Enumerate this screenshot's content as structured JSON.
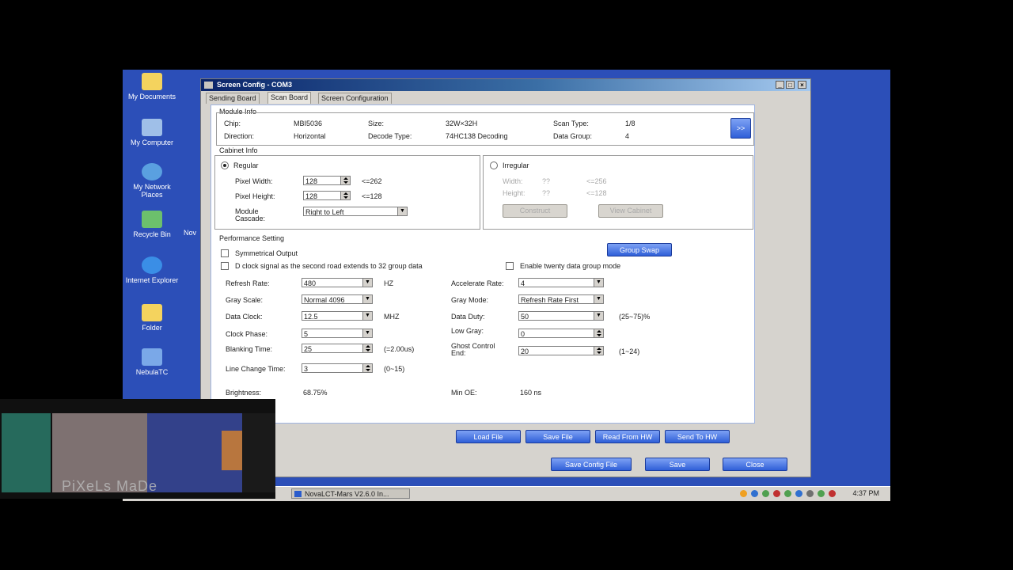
{
  "desktop": {
    "icons": [
      {
        "label": "My Documents",
        "icon": "folder-icon",
        "color": "#f4d35e"
      },
      {
        "label": "My Computer",
        "icon": "computer-icon",
        "color": "#9fbfe8"
      },
      {
        "label": "My Network Places",
        "icon": "network-icon",
        "color": "#5aa0e0"
      },
      {
        "label": "Recycle Bin",
        "icon": "recycle-bin-icon",
        "color": "#6cc06c"
      },
      {
        "label": "Internet Explorer",
        "icon": "internet-explorer-icon",
        "color": "#3a8ee6"
      },
      {
        "label": "Folder",
        "icon": "folder-icon",
        "color": "#f4d35e"
      },
      {
        "label": "NebulaTC",
        "icon": "app-icon",
        "color": "#7aa8e8"
      }
    ],
    "partial_label": "Nov"
  },
  "window": {
    "title": "Screen Config - COM3",
    "tabs": [
      "Sending Board",
      "Scan Board",
      "Screen Configuration"
    ],
    "active_tab": "Scan Board"
  },
  "module_info": {
    "group_label": "Module Info",
    "chip_label": "Chip:",
    "chip": "MBI5036",
    "size_label": "Size:",
    "size": "32W×32H",
    "scan_type_label": "Scan Type:",
    "scan_type": "1/8",
    "direction_label": "Direction:",
    "direction": "Horizontal",
    "decode_type_label": "Decode Type:",
    "decode_type": "74HC138 Decoding",
    "data_group_label": "Data Group:",
    "data_group": "4",
    "more_button": ">>"
  },
  "cabinet_info": {
    "group_label": "Cabinet Info",
    "regular_label": "Regular",
    "pixel_width_label": "Pixel Width:",
    "pixel_width": "128",
    "pixel_width_limit": "<=262",
    "pixel_height_label": "Pixel Height:",
    "pixel_height": "128",
    "pixel_height_limit": "<=128",
    "module_cascade_label": "Module Cascade:",
    "module_cascade": "Right to Left",
    "irregular_label": "Irregular",
    "width_label": "Width:",
    "width": "??",
    "width_limit": "<=256",
    "height_label": "Height:",
    "height": "??",
    "height_limit": "<=128",
    "construct_button": "Construct",
    "view_cabinet_button": "View Cabinet"
  },
  "performance": {
    "group_label": "Performance Setting",
    "group_swap_button": "Group Swap",
    "symmetrical_output": "Symmetrical Output",
    "d_clock_option": "D clock signal as the second road extends to 32 group data",
    "twenty_group_option": "Enable twenty data group mode",
    "refresh_rate_label": "Refresh Rate:",
    "refresh_rate": "480",
    "refresh_rate_unit": "HZ",
    "gray_scale_label": "Gray Scale:",
    "gray_scale": "Normal 4096",
    "data_clock_label": "Data Clock:",
    "data_clock": "12.5",
    "data_clock_unit": "MHZ",
    "clock_phase_label": "Clock Phase:",
    "clock_phase": "5",
    "blanking_time_label": "Blanking Time:",
    "blanking_time": "25",
    "blanking_time_note": "(=2.00us)",
    "line_change_label": "Line Change Time:",
    "line_change": "3",
    "line_change_note": "(0~15)",
    "accelerate_rate_label": "Accelerate Rate:",
    "accelerate_rate": "4",
    "gray_mode_label": "Gray Mode:",
    "gray_mode": "Refresh Rate First",
    "data_duty_label": "Data Duty:",
    "data_duty": "50",
    "data_duty_note": "(25~75)%",
    "low_gray_label": "Low Gray:",
    "low_gray": "0",
    "ghost_label": "Ghost Control End:",
    "ghost": "20",
    "ghost_note": "(1~24)",
    "brightness_label": "Brightness:",
    "brightness": "68.75%",
    "min_oe_label": "Min OE:",
    "min_oe": "160 ns"
  },
  "file_buttons": [
    "Load File",
    "Save File",
    "Read From HW",
    "Send To HW"
  ],
  "footer_buttons": [
    "Save Config File",
    "Save",
    "Close"
  ],
  "taskbar": {
    "task_label": "NovaLCT-Mars V2.6.0 In...",
    "clock": "4:37 PM"
  },
  "video_overlay": {
    "caption": "PiXeLs MaDe"
  },
  "colors": {
    "desktop": "#2c4fb8",
    "button_blue": "#2f5fd8",
    "panel_border": "#9fb4e2"
  }
}
